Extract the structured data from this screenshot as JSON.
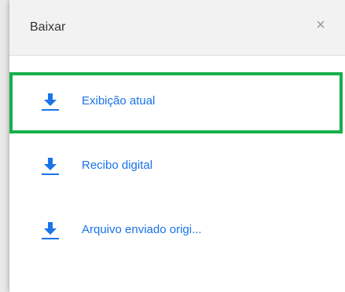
{
  "dialog": {
    "title": "Baixar",
    "close_glyph": "×"
  },
  "items": [
    {
      "label": "Exibição atual",
      "icon": "download-icon"
    },
    {
      "label": "Recibo digital",
      "icon": "download-icon"
    },
    {
      "label": "Arquivo enviado origi...",
      "icon": "download-icon"
    }
  ],
  "colors": {
    "accent": "#1a73e8",
    "highlight": "#16b04a",
    "header_bg": "#f2f2f2"
  }
}
